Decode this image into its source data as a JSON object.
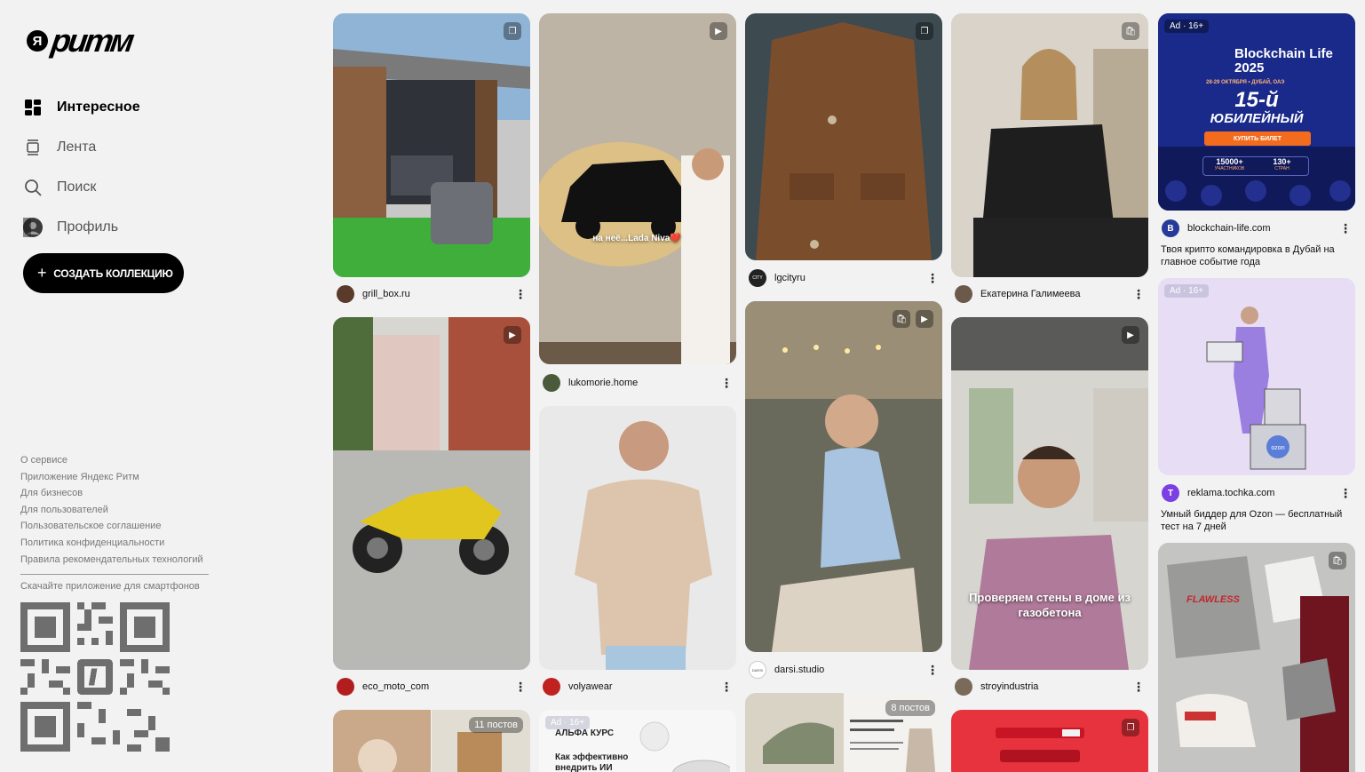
{
  "logo": {
    "mark": "Я",
    "wordmark": "ритм"
  },
  "nav": [
    {
      "label": "Интересное",
      "icon": "grid-icon",
      "active": true
    },
    {
      "label": "Лента",
      "icon": "feed-icon",
      "active": false
    },
    {
      "label": "Поиск",
      "icon": "search-icon",
      "active": false
    },
    {
      "label": "Профиль",
      "icon": "avatar",
      "active": false
    }
  ],
  "create_button": {
    "label": "СОЗДАТЬ КОЛЛЕКЦИЮ",
    "icon": "plus-icon"
  },
  "footer": {
    "links": [
      "О сервисе",
      "Приложение Яндекс Ритм",
      "Для бизнесов",
      "Для пользователей",
      "Пользовательское соглашение",
      "Политика конфиденциальности",
      "Правила рекомендательных технологий"
    ],
    "download_text": "Скачайте приложение для смартфонов"
  },
  "feed": {
    "col1": {
      "card1": {
        "author": "grill_box.ru",
        "badge": "gallery-icon"
      },
      "card2": {
        "author": "eco_moto_com",
        "badge": "play-icon"
      },
      "card3": {
        "posts": "11 постов"
      }
    },
    "col2": {
      "card1": {
        "author": "lukomorie.home",
        "badge": "play-icon",
        "caption": "на неё...Lada Niva❤️"
      },
      "card2": {
        "author": "volyawear"
      },
      "card3": {
        "ad": "Ad · 16+",
        "brand": "АЛЬФА КУРС",
        "headline": "Как эффективно внедрить ИИ"
      }
    },
    "col3": {
      "card1": {
        "author": "lgcityru",
        "badge": "gallery-icon",
        "avatar_text": "CITY"
      },
      "card2": {
        "author": "darsi.studio",
        "avatar_text": "DARSI"
      },
      "card3": {
        "posts": "8 постов"
      }
    },
    "col4": {
      "card1": {
        "author": "Екатерина Галимеева",
        "badge": "shopping-bag-icon"
      },
      "card2": {
        "author": "stroyindustria",
        "badge": "play-icon",
        "caption": "Проверяем стены в доме из газобетона"
      },
      "card3": {
        "badge": "gallery-icon"
      }
    },
    "col5": {
      "card1": {
        "ad": "Ad · 16+",
        "author": "blockchain-life.com",
        "desc": "Твоя крипто командировка в Дубай на главное событие года",
        "banner_title": "Blockchain Life 2025",
        "banner_date": "28-29 ОКТЯБРЯ • ДУБАЙ, ОАЭ",
        "banner_big": "15-й",
        "banner_sub": "ЮБИЛЕЙНЫЙ",
        "banner_cta": "КУПИТЬ БИЛЕТ",
        "stat1": "15000+",
        "stat1_label": "УЧАСТНИКОВ",
        "stat2": "130+",
        "stat2_label": "СТРАН",
        "avatar_text": "B"
      },
      "card2": {
        "ad": "Ad · 16+",
        "author": "reklama.tochka.com",
        "desc": "Умный биддер для Ozon — бесплатный тест на 7 дней",
        "avatar_text": "T",
        "box_text": "ozon"
      },
      "card3": {
        "badge": "shopping-bag-icon",
        "shirt_text": "FLAWLESS"
      }
    }
  },
  "colors": {
    "background": "#f2f2f2",
    "accent": "#000000",
    "tochka_purple": "#7b3fe4",
    "blockchain_blue": "#1a2a8a",
    "cta_orange": "#f36b1c"
  }
}
